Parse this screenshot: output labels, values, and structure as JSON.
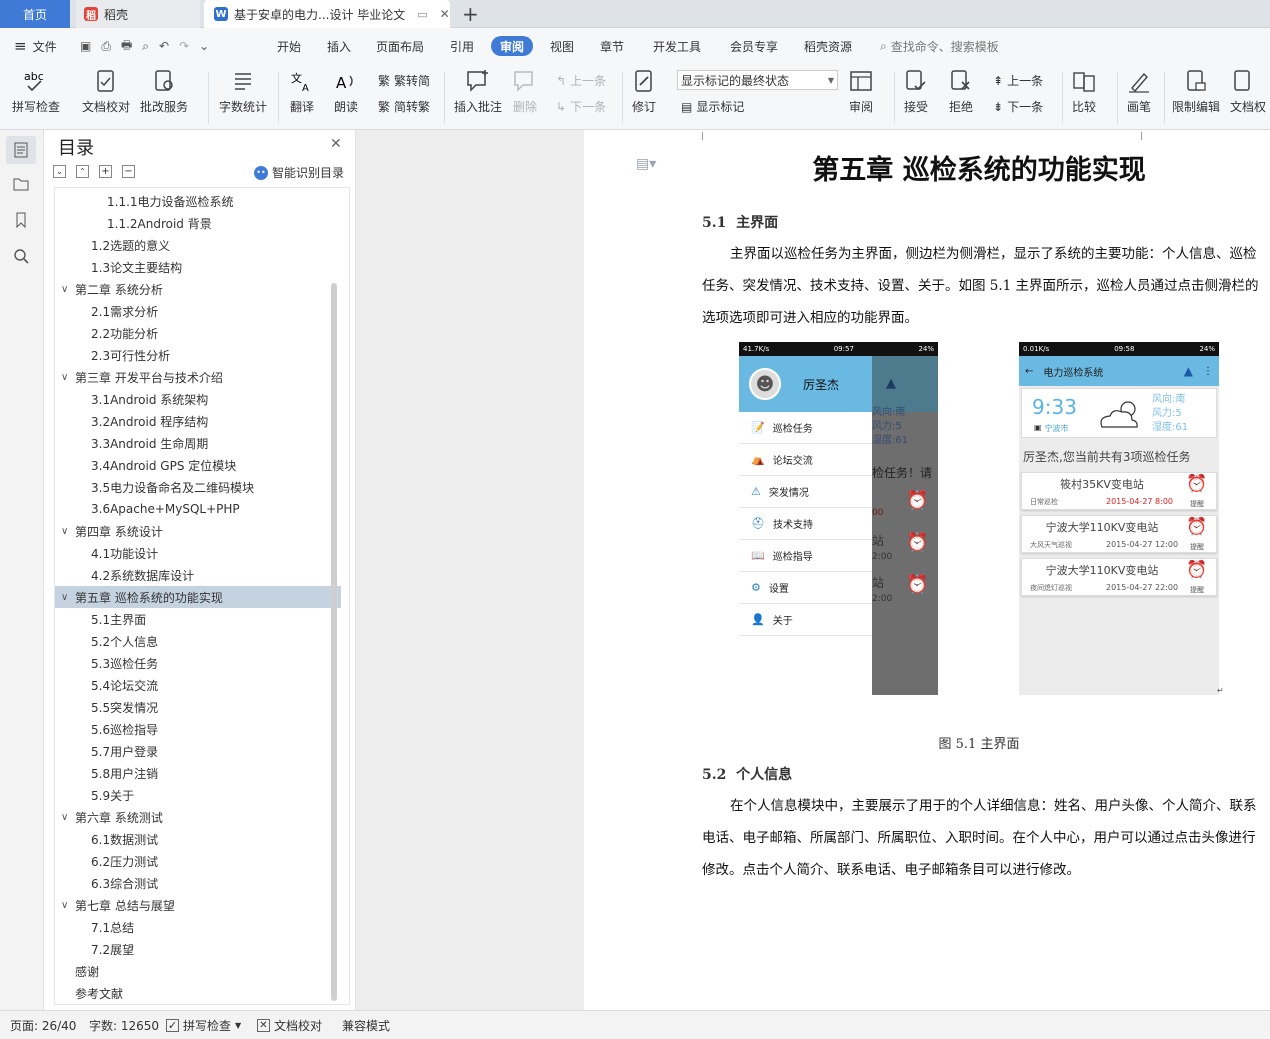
{
  "tabs": {
    "home": "首页",
    "daoke": "稻壳",
    "doc": "基于安卓的电力...设计 毕业论文"
  },
  "menu": {
    "file": "文件",
    "items": [
      "开始",
      "插入",
      "页面布局",
      "引用",
      "审阅",
      "视图",
      "章节",
      "开发工具",
      "会员专享",
      "稻壳资源"
    ],
    "search": "查找命令、搜索模板"
  },
  "ribbon": {
    "spell": "拼写检查",
    "proof": "文档校对",
    "annot": "批改服务",
    "count": "字数统计",
    "translate": "翻译",
    "read": "朗读",
    "trad": "繁转简",
    "simp": "简转繁",
    "insert_comment": "插入批注",
    "delete": "删除",
    "prev": "上一条",
    "next": "下一条",
    "revise": "修订",
    "markup_select": "显示标记的最终状态",
    "show_markup": "显示标记",
    "review": "审阅",
    "accept": "接受",
    "reject": "拒绝",
    "prev2": "上一条",
    "next2": "下一条",
    "compare": "比较",
    "pen": "画笔",
    "restrict": "限制编辑",
    "docperm": "文档权"
  },
  "toc": {
    "title": "目录",
    "smart": "智能识别目录",
    "items": [
      {
        "t": "1.1.1电力设备巡检系统",
        "lv": 3
      },
      {
        "t": "1.1.2Android 背景",
        "lv": 3
      },
      {
        "t": "1.2选题的意义",
        "lv": 2
      },
      {
        "t": "1.3论文主要结构",
        "lv": 2
      },
      {
        "t": "第二章  系统分析",
        "lv": 1
      },
      {
        "t": "2.1需求分析",
        "lv": 2
      },
      {
        "t": "2.2功能分析",
        "lv": 2
      },
      {
        "t": "2.3可行性分析",
        "lv": 2
      },
      {
        "t": "第三章  开发平台与技术介绍",
        "lv": 1
      },
      {
        "t": "3.1Android 系统架构",
        "lv": 2
      },
      {
        "t": "3.2Android 程序结构",
        "lv": 2
      },
      {
        "t": "3.3Android 生命周期",
        "lv": 2
      },
      {
        "t": "3.4Android GPS 定位模块",
        "lv": 2
      },
      {
        "t": "3.5电力设备命名及二维码模块",
        "lv": 2
      },
      {
        "t": "3.6Apache+MySQL+PHP",
        "lv": 2
      },
      {
        "t": "第四章  系统设计",
        "lv": 1
      },
      {
        "t": "4.1功能设计",
        "lv": 2
      },
      {
        "t": "4.2系统数据库设计",
        "lv": 2
      },
      {
        "t": "第五章  巡检系统的功能实现",
        "lv": 1,
        "sel": true
      },
      {
        "t": "5.1主界面",
        "lv": 2
      },
      {
        "t": "5.2个人信息",
        "lv": 2
      },
      {
        "t": "5.3巡检任务",
        "lv": 2
      },
      {
        "t": "5.4论坛交流",
        "lv": 2
      },
      {
        "t": "5.5突发情况",
        "lv": 2
      },
      {
        "t": "5.6巡检指导",
        "lv": 2
      },
      {
        "t": "5.7用户登录",
        "lv": 2
      },
      {
        "t": "5.8用户注销",
        "lv": 2
      },
      {
        "t": "5.9关于",
        "lv": 2
      },
      {
        "t": "第六章  系统测试",
        "lv": 1
      },
      {
        "t": "6.1数据测试",
        "lv": 2
      },
      {
        "t": "6.2压力测试",
        "lv": 2
      },
      {
        "t": "6.3综合测试",
        "lv": 2
      },
      {
        "t": "第七章  总结与展望",
        "lv": 1
      },
      {
        "t": "7.1总结",
        "lv": 2
      },
      {
        "t": "7.2展望",
        "lv": 2
      },
      {
        "t": "感谢",
        "lv": 0
      },
      {
        "t": "参考文献",
        "lv": 0
      }
    ]
  },
  "doc": {
    "chapter": "第五章  巡检系统的功能实现",
    "s1_num": "5.1",
    "s1_title": "主界面",
    "p1": "主界面以巡检任务为主界面，侧边栏为侧滑栏，显示了系统的主要功能：个人信息、巡检任务、突发情况、技术支持、设置、关于。如图 5.1 主界面所示，巡检人员通过点击侧滑栏的选项选项即可进入相应的功能界面。",
    "caption": "图 5.1  主界面",
    "s2_num": "5.2",
    "s2_title": "个人信息",
    "p2": "在个人信息模块中，主要展示了用于的个人详细信息：姓名、用户头像、个人简介、联系电话、电子邮箱、所属部门、所属职位、入职时间。在个人中心，用户可以通过点击头像进行修改。点击个人简介、联系电话、电子邮箱条目可以进行修改。"
  },
  "phone1": {
    "status_left": "41.7K/s",
    "status_time": "09:57",
    "status_right": "24%",
    "user": "厉圣杰",
    "items": [
      "巡检任务",
      "论坛交流",
      "突发情况",
      "技术支持",
      "巡检指导",
      "设置",
      "关于"
    ],
    "behind": [
      "风向:南",
      "风力:5",
      "湿度:61",
      "检任务！请",
      "00",
      "站",
      "2:00",
      "站",
      "2:00"
    ]
  },
  "phone2": {
    "status_left": "0.01K/s",
    "status_time": "09:58",
    "status_right": "24%",
    "title": "电力巡检系统",
    "clock": "9:33",
    "city": "宁波市",
    "wind_dir": "风向:南",
    "wind": "风力:5",
    "humidity": "湿度:61",
    "banner": "厉圣杰,您当前共有3项巡检任务",
    "alarm": "提醒",
    "tasks": [
      {
        "name": "筱村35KV变电站",
        "type": "日常巡检",
        "time": "2015-04-27 8:00"
      },
      {
        "name": "宁波大学110KV变电站",
        "type": "大风天气巡视",
        "time": "2015-04-27 12:00"
      },
      {
        "name": "宁波大学110KV变电站",
        "type": "夜间熄灯巡视",
        "time": "2015-04-27 22:00"
      }
    ]
  },
  "status": {
    "page": "页面: 26/40",
    "words": "字数: 12650",
    "spell": "拼写检查",
    "proof": "文档校对",
    "compat": "兼容模式"
  },
  "colors": {
    "accent": "#3f7bd6",
    "toc_sel": "#c5d3e1",
    "phone_header": "#6ab9e2",
    "date_red": "#e02020"
  }
}
